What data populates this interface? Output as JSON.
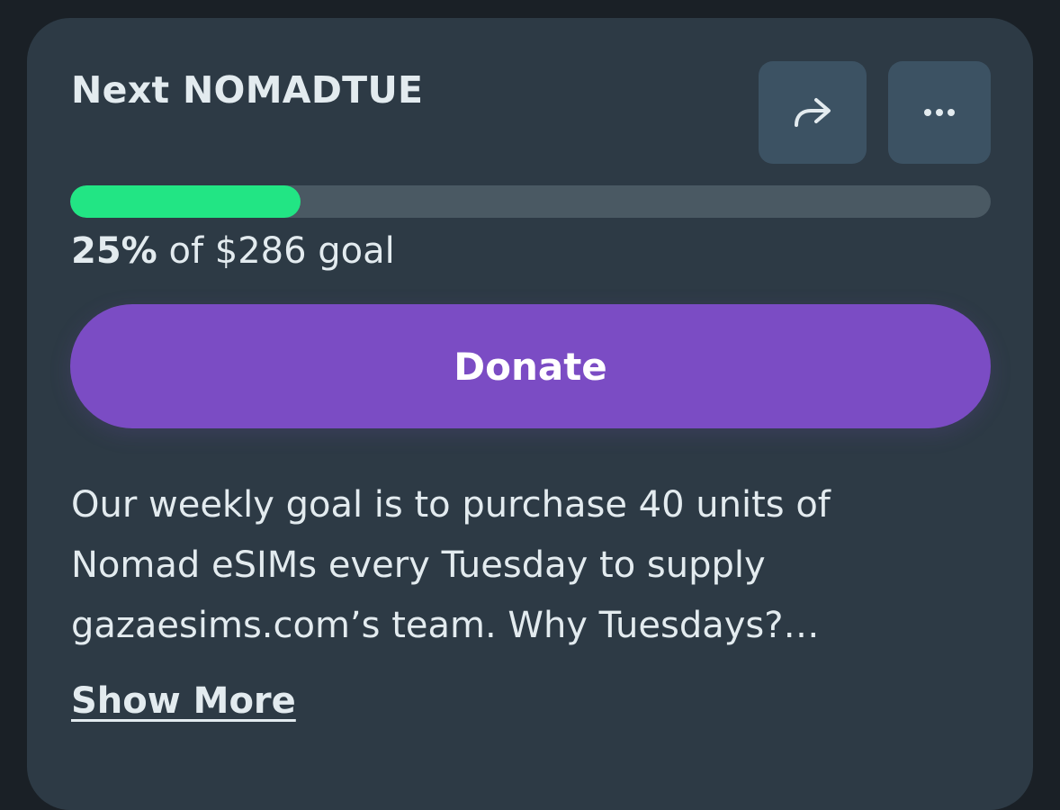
{
  "campaign": {
    "title": "Next NOMADTUE"
  },
  "actions": {
    "share_icon": "share-arrow-icon",
    "more_icon": "ellipsis-icon"
  },
  "progress": {
    "percent": 25,
    "percent_label": "25%",
    "goal_suffix": "of $286 goal",
    "fill_color": "#22e584"
  },
  "donate": {
    "label": "Donate",
    "color": "#7b4cc4"
  },
  "description": {
    "lines": [
      "Our weekly goal is to purchase 40 units of",
      "Nomad eSIMs every Tuesday to supply",
      "gazaesims.com’s team. Why Tuesdays?…"
    ]
  },
  "show_more_label": "Show More"
}
